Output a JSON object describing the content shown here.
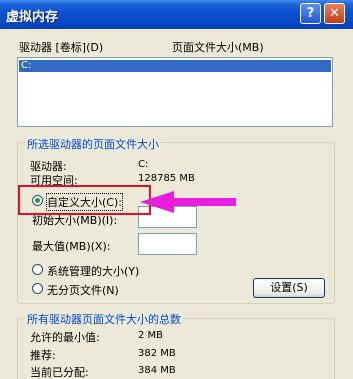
{
  "window": {
    "title": "虚拟内存",
    "help_label": "?",
    "close_label": "✕"
  },
  "drives": {
    "col_drive": "驱动器 [卷标](D)",
    "col_pagefile": "页面文件大小(MB)",
    "rows": [
      {
        "drive": "C:"
      }
    ]
  },
  "selected": {
    "group_title": "所选驱动器的页面文件大小",
    "drive_label": "驱动器:",
    "drive_value": "C:",
    "space_label": "可用空间:",
    "space_value": "128785 MB",
    "custom_label": "自定义大小(C):",
    "initial_label": "初始大小(MB)(I):",
    "max_label": "最大值(MB)(X):",
    "system_label": "系统管理的大小(Y)",
    "nopage_label": "无分页文件(N)",
    "set_button": "设置(S)",
    "custom_selected": true
  },
  "totals": {
    "group_title": "所有驱动器页面文件大小的总数",
    "min_label": "允许的最小值:",
    "min_value": "2 MB",
    "rec_label": "推荐:",
    "rec_value": "382 MB",
    "cur_label": "当前已分配:",
    "cur_value": "384 MB"
  },
  "colors": {
    "annotation": "#e4121b",
    "arrow": "#e91edc",
    "selection": "#316ac5"
  }
}
